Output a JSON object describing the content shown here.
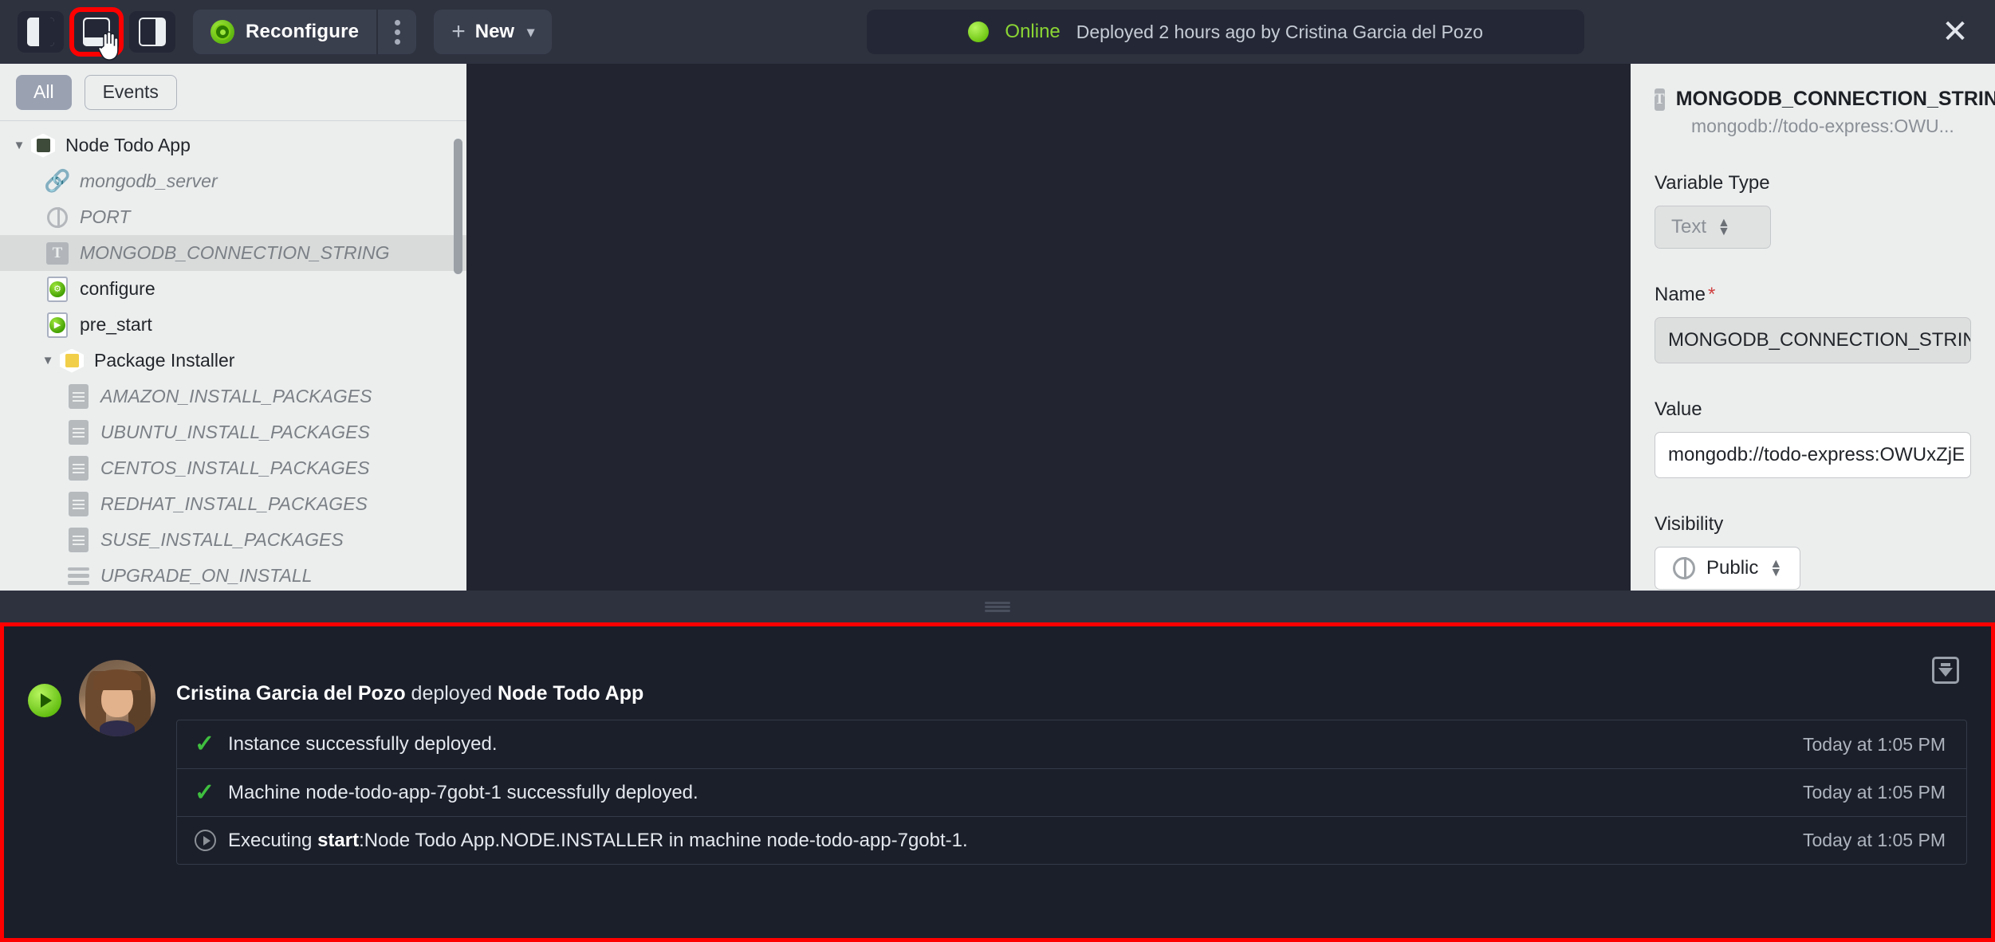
{
  "toolbar": {
    "panel_buttons": [
      {
        "name": "panel-left-toggle",
        "icon": "panel-left-icon"
      },
      {
        "name": "panel-bottom-toggle",
        "icon": "panel-bottom-icon",
        "highlighted": true
      },
      {
        "name": "panel-right-toggle",
        "icon": "panel-right-icon"
      }
    ],
    "reconfigure_label": "Reconfigure",
    "new_label": "New",
    "status": {
      "state": "Online",
      "description": "Deployed 2 hours ago by Cristina Garcia del Pozo",
      "dot_color": "#7ed321",
      "state_color": "#8bd534"
    },
    "close_label": "✕"
  },
  "left_panel": {
    "filters": [
      {
        "label": "All",
        "active": true
      },
      {
        "label": "Events",
        "active": false
      }
    ],
    "tree": [
      {
        "label": "Node Todo App",
        "icon": "app-icon",
        "depth": 0,
        "twisty": "▼",
        "style": "normal"
      },
      {
        "label": "mongodb_server",
        "icon": "link-icon",
        "depth": 1,
        "twisty": "",
        "style": "dim"
      },
      {
        "label": "PORT",
        "icon": "globe-icon",
        "depth": 1,
        "twisty": "",
        "style": "dim"
      },
      {
        "label": "MONGODB_CONNECTION_STRING",
        "icon": "text-variable-icon",
        "depth": 1,
        "twisty": "",
        "style": "dim",
        "selected": true
      },
      {
        "label": "configure",
        "icon": "script-gear-icon",
        "depth": 1,
        "twisty": "",
        "style": "normal"
      },
      {
        "label": "pre_start",
        "icon": "script-play-icon",
        "depth": 1,
        "twisty": "",
        "style": "normal"
      },
      {
        "label": "Package Installer",
        "icon": "package-icon",
        "depth": 1,
        "twisty": "▼",
        "style": "normal"
      },
      {
        "label": "AMAZON_INSTALL_PACKAGES",
        "icon": "file-icon",
        "depth": 2,
        "twisty": "",
        "style": "dim"
      },
      {
        "label": "UBUNTU_INSTALL_PACKAGES",
        "icon": "file-icon",
        "depth": 2,
        "twisty": "",
        "style": "dim"
      },
      {
        "label": "CENTOS_INSTALL_PACKAGES",
        "icon": "file-icon",
        "depth": 2,
        "twisty": "",
        "style": "dim"
      },
      {
        "label": "REDHAT_INSTALL_PACKAGES",
        "icon": "file-icon",
        "depth": 2,
        "twisty": "",
        "style": "dim"
      },
      {
        "label": "SUSE_INSTALL_PACKAGES",
        "icon": "file-icon",
        "depth": 2,
        "twisty": "",
        "style": "dim"
      },
      {
        "label": "UPGRADE_ON_INSTALL",
        "icon": "lines-icon",
        "depth": 2,
        "twisty": "",
        "style": "dim"
      }
    ]
  },
  "right_panel": {
    "title": "MONGODB_CONNECTION_STRIN",
    "subtitle": "mongodb://todo-express:OWU...",
    "variable_type_label": "Variable Type",
    "variable_type_value": "Text",
    "name_label": "Name",
    "name_required": "*",
    "name_value": "MONGODB_CONNECTION_STRING",
    "value_label": "Value",
    "value_value": "mongodb://todo-express:OWUxZjE",
    "visibility_label": "Visibility",
    "visibility_value": "Public"
  },
  "log_panel": {
    "actor": "Cristina Garcia del Pozo",
    "action": " deployed ",
    "target": "Node Todo App",
    "download_icon": "download-icon",
    "rows": [
      {
        "icon": "check-icon",
        "message": "Instance successfully deployed.",
        "time": "Today at 1:05 PM"
      },
      {
        "icon": "check-icon",
        "message": "Machine node-todo-app-7gobt-1 successfully deployed.",
        "time": "Today at 1:05 PM"
      },
      {
        "icon": "run-icon",
        "message_pre": "Executing ",
        "message_bold": "start",
        "message_post": ":Node Todo App.NODE.INSTALLER in machine node-todo-app-7gobt-1.",
        "time": "Today at 1:05 PM"
      }
    ]
  }
}
